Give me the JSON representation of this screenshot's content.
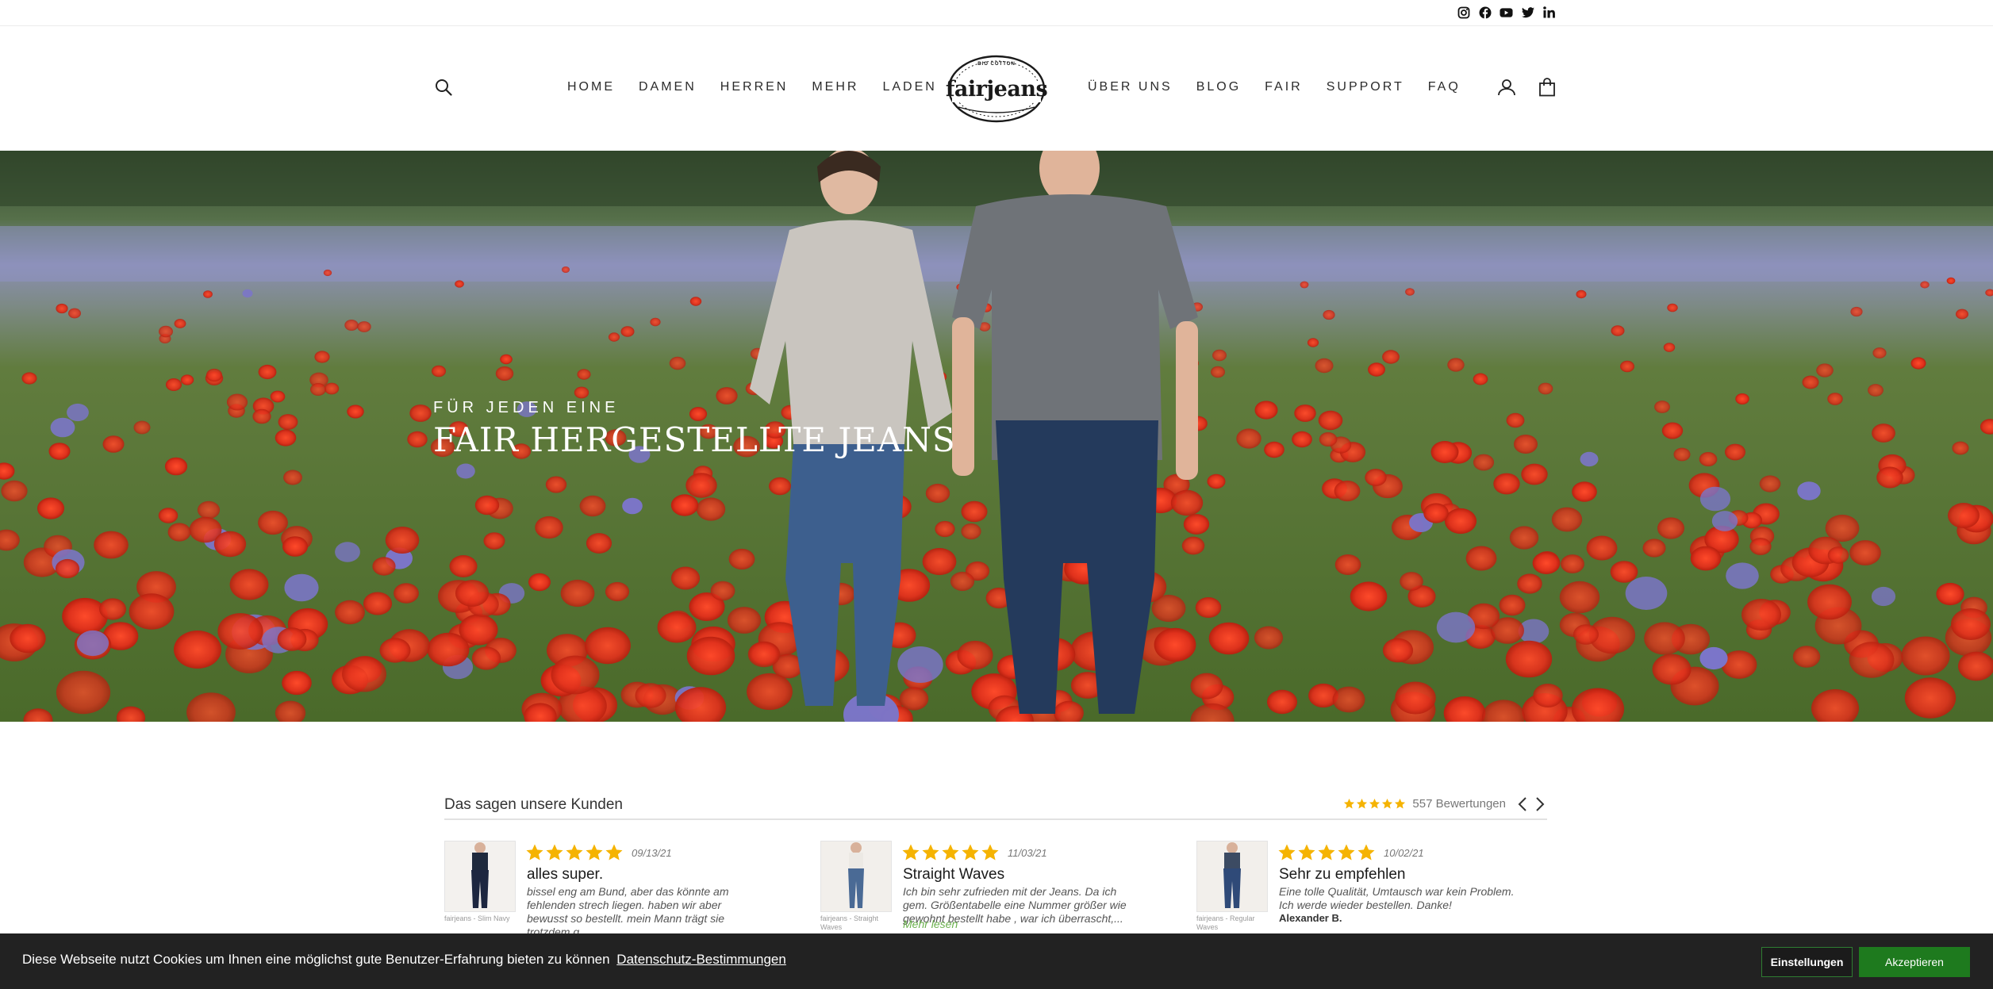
{
  "social": {
    "icons": [
      "instagram-icon",
      "facebook-icon",
      "youtube-icon",
      "twitter-icon",
      "linkedin-icon"
    ]
  },
  "header": {
    "nav_left": [
      "HOME",
      "DAMEN",
      "HERREN",
      "MEHR",
      "LADEN"
    ],
    "nav_right": [
      "ÜBER UNS",
      "BLOG",
      "FAIR",
      "SUPPORT",
      "FAQ"
    ],
    "logo": {
      "text": "fairjeans",
      "top_text": "BIO COTTON"
    }
  },
  "hero": {
    "subtitle": "FÜR JEDEN EINE",
    "title": "FAIR HERGESTELLTE JEANS"
  },
  "reviews": {
    "title": "Das sagen unsere Kunden",
    "rating_stars": 5,
    "count_text": "557 Bewertungen",
    "items": [
      {
        "stars": 5,
        "date": "09/13/21",
        "title": "alles super.",
        "body": "bissel eng am Bund, aber das könnte am fehlenden strech liegen. haben wir aber bewusst so bestellt. mein Mann trägt sie trotzdem g...",
        "thumb_caption": "fairjeans - Slim Navy",
        "author": "",
        "more": ""
      },
      {
        "stars": 5,
        "date": "11/03/21",
        "title": "Straight Waves",
        "body": "Ich bin sehr zufrieden mit der Jeans. Da ich gem. Größentabelle eine Nummer größer wie gewohnt bestellt habe , war ich überrascht,...",
        "thumb_caption": "fairjeans - Straight Waves",
        "author": "",
        "more": "Mehr lesen"
      },
      {
        "stars": 5,
        "date": "10/02/21",
        "title": "Sehr zu empfehlen",
        "body": "Eine tolle Qualität, Umtausch war kein Problem. Ich werde wieder bestellen. Danke!",
        "thumb_caption": "fairjeans - Regular Waves",
        "author": "Alexander B.",
        "more": ""
      }
    ]
  },
  "cookie": {
    "text": "Diese Webseite nutzt Cookies um Ihnen eine möglichst gute Benutzer-Erfahrung bieten zu können",
    "link": "Datenschutz-Bestimmungen",
    "settings": "Einstellungen",
    "accept": "Akzeptieren"
  },
  "colors": {
    "star": "#f5b301",
    "accept_green": "#1e7a1e",
    "cookie_bg": "#222222",
    "poppy_red": "#d7301f"
  }
}
